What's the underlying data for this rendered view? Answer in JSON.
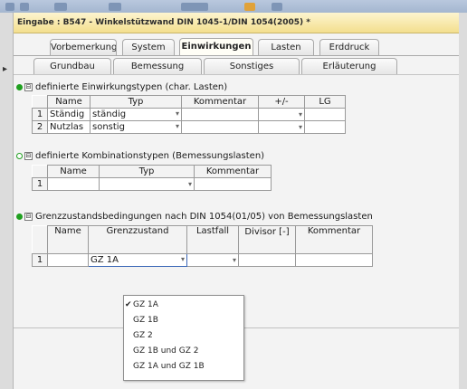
{
  "window": {
    "title": "Eingabe : B547 - Winkelstützwand DIN 1045-1/DIN 1054(2005) *"
  },
  "tabs": {
    "row1": [
      "Vorbemerkung",
      "System",
      "Einwirkungen",
      "Lasten",
      "Erddruck"
    ],
    "row2": [
      "Grundbau",
      "Bemessung",
      "Sonstiges",
      "Erläuterung"
    ],
    "active": "Einwirkungen"
  },
  "section1": {
    "title": "definierte Einwirkungstypen (char. Lasten)",
    "columns": [
      "Name",
      "Typ",
      "Kommentar",
      "+/-",
      "LG"
    ],
    "rows": [
      {
        "num": "1",
        "name": "Ständig",
        "typ": "ständig",
        "kommentar": "",
        "pm": "",
        "lg": ""
      },
      {
        "num": "2",
        "name": "Nutzlas",
        "typ": "sonstig",
        "kommentar": "",
        "pm": "",
        "lg": ""
      }
    ]
  },
  "section2": {
    "title": "definierte Kombinationstypen (Bemessungslasten)",
    "columns": [
      "Name",
      "Typ",
      "Kommentar"
    ],
    "rows": [
      {
        "num": "1",
        "name": "",
        "typ": "",
        "kommentar": ""
      }
    ]
  },
  "section3": {
    "title": "Grenzzustandsbedingungen nach DIN 1054(01/05) von Bemessungslasten",
    "columns": [
      "Name",
      "Grenzzustand",
      "Lastfall",
      "Divisor [-]",
      "Kommentar"
    ],
    "rows": [
      {
        "num": "1",
        "name": "",
        "grenzzustand": "GZ 1A",
        "lastfall": "",
        "divisor": "",
        "kommentar": ""
      }
    ]
  },
  "dropdown": {
    "options": [
      "GZ 1A",
      "GZ 1B",
      "GZ 2",
      "GZ 1B und GZ 2",
      "GZ 1A und GZ 1B"
    ],
    "selected": "GZ 1A"
  },
  "icons": {
    "dropdown_arrow": "▾",
    "checkmark": "✔",
    "collapse": "⊟"
  }
}
